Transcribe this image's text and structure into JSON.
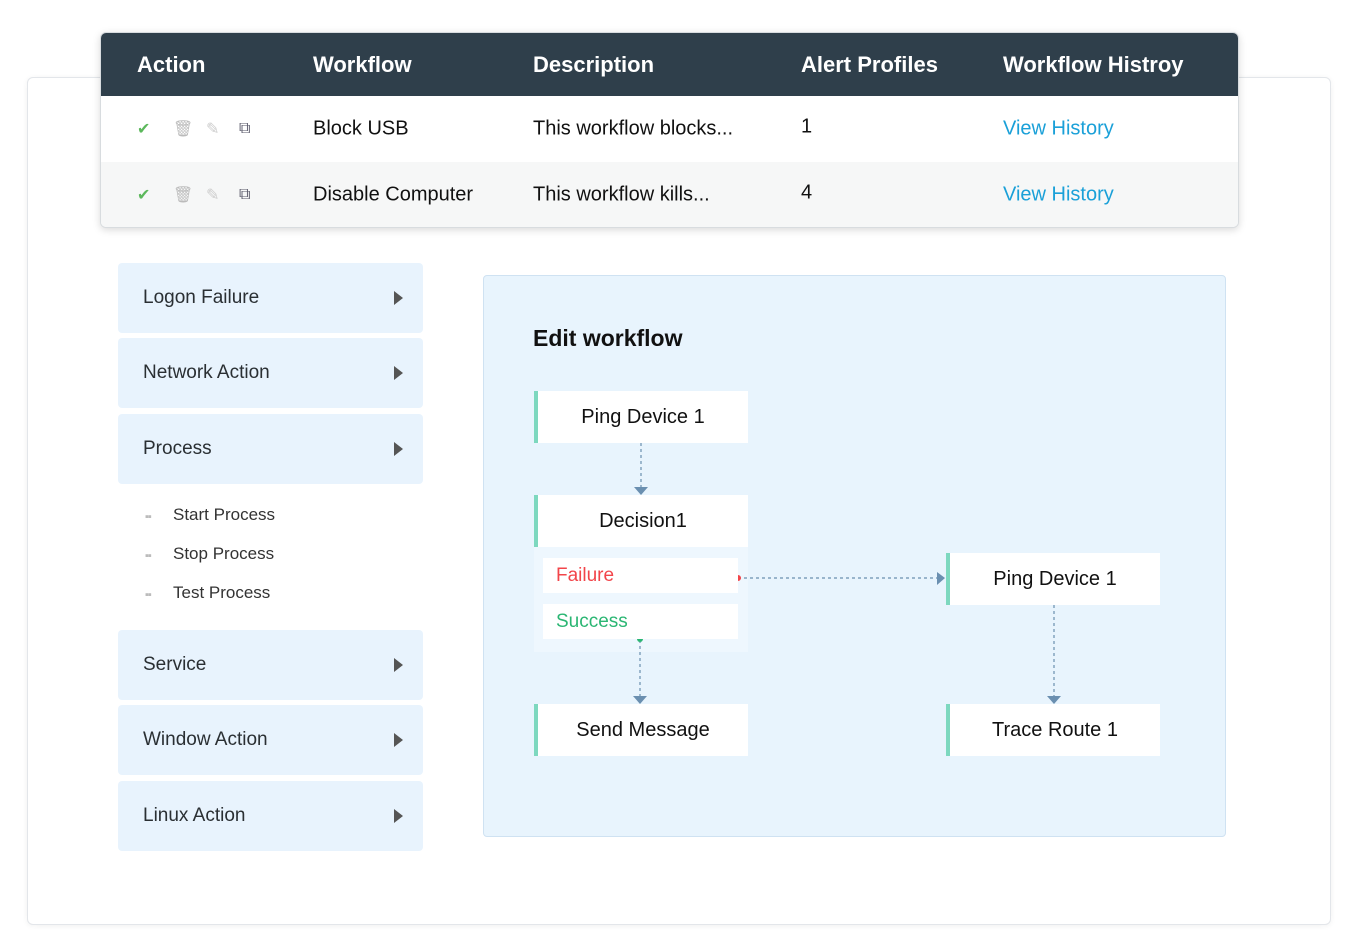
{
  "table": {
    "headers": [
      "Action",
      "Workflow",
      "Description",
      "Alert Profiles",
      "Workflow Histroy"
    ],
    "rows": [
      {
        "workflow": "Block USB",
        "description": "This workflow blocks...",
        "alert_profiles": "1",
        "history": "View History"
      },
      {
        "workflow": "Disable Computer",
        "description": "This workflow kills...",
        "alert_profiles": "4",
        "history": "View History"
      }
    ],
    "action_icons": [
      "check-circle-icon",
      "trash-icon",
      "pencil-icon",
      "copy-icon"
    ]
  },
  "sidebar": {
    "items": [
      "Logon Failure",
      "Network Action",
      "Process",
      "Service",
      "Window Action",
      "Linux Action"
    ],
    "process_subitems": [
      "Start Process",
      "Stop Process",
      "Test Process"
    ]
  },
  "editor": {
    "title": "Edit workflow",
    "nodes": {
      "ping1": "Ping Device 1",
      "decision": "Decision1",
      "failure": "Failure",
      "success": "Success",
      "send": "Send Message",
      "ping2": "Ping Device 1",
      "trace": "Trace Route 1"
    },
    "colors": {
      "failure": "#f2454a",
      "success": "#2bb673",
      "accent": "#7dd8bf",
      "connector": "#6a8fb0"
    }
  }
}
